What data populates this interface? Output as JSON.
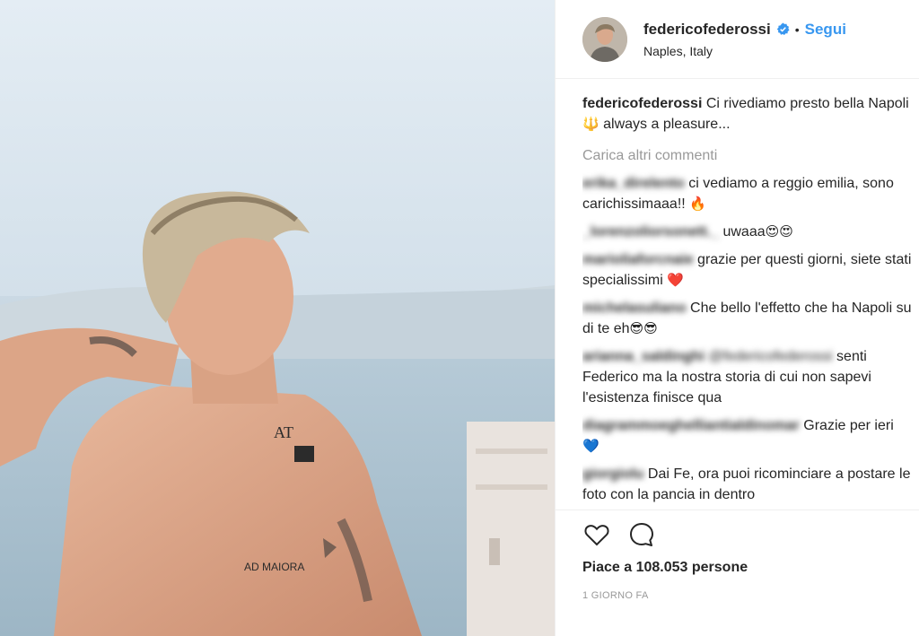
{
  "post": {
    "username": "federicofederossi",
    "follow_label": "Segui",
    "separator": "•",
    "location": "Naples, Italy"
  },
  "caption": {
    "author": "federicofederossi",
    "text_part1": " Ci rivediamo presto bella Napoli ",
    "emoji": "🔱",
    "text_part2": " always a pleasure..."
  },
  "load_more_label": "Carica altri commenti",
  "comments": [
    {
      "author": "erika_direlento",
      "text": " ci vediamo a reggio emilia, sono carichissimaaa!! ",
      "emoji": "🔥"
    },
    {
      "author": "_lorenzoliorsonett._",
      "text": " uwaaa",
      "emoji": "😍😍"
    },
    {
      "author": "marioliaforcnaie",
      "text": " grazie per questi giorni, siete stati specialissimi ",
      "emoji": "❤️"
    },
    {
      "author": "michelasuliano",
      "text": " Che bello l'effetto che ha Napoli su di te eh",
      "emoji": "😎😎"
    },
    {
      "author": "arianna_saldinghi",
      "mention": "@federicofederossi",
      "text": " senti Federico ma la nostra storia di cui non sapevi l'esistenza finisce qua",
      "emoji": ""
    },
    {
      "author": "diagrammoeghelliantialdinomar",
      "text": " Grazie per ieri ",
      "emoji": "💙"
    },
    {
      "author": "giorgiolu",
      "text": " Dai Fe, ora puoi ricominciare a postare le foto con la pancia in dentro",
      "emoji": ""
    }
  ],
  "likes_label": "Piace a 108.053 persone",
  "time_label": "1 GIORNO FA",
  "icons": {
    "like": "heart-icon",
    "comment": "speech-bubble-icon",
    "verified": "verified-badge-icon"
  },
  "colors": {
    "accent": "#3897f0",
    "text": "#262626",
    "muted": "#999999"
  }
}
